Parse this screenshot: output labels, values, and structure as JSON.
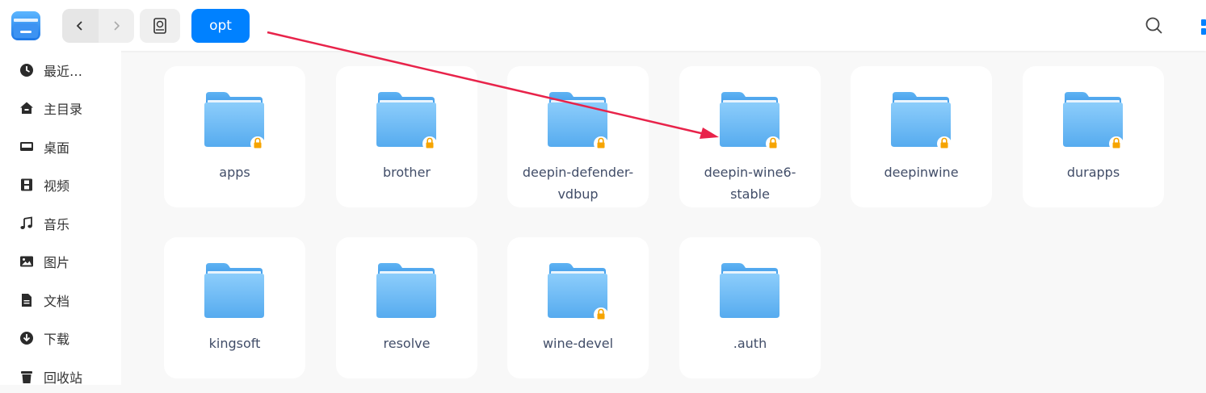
{
  "app": {
    "icon": "file-manager-icon"
  },
  "toolbar": {
    "back_icon": "chevron-left-icon",
    "forward_icon": "chevron-right-icon",
    "disk_icon": "hard-disk-icon",
    "breadcrumb": "opt",
    "search_icon": "search-icon",
    "view_icon": "view-mode-icon"
  },
  "sidebar": {
    "items": [
      {
        "label": "最近…",
        "icon": "clock-icon"
      },
      {
        "label": "主目录",
        "icon": "home-icon"
      },
      {
        "label": "桌面",
        "icon": "desktop-icon"
      },
      {
        "label": "视频",
        "icon": "film-icon"
      },
      {
        "label": "音乐",
        "icon": "music-note-icon"
      },
      {
        "label": "图片",
        "icon": "image-icon"
      },
      {
        "label": "文档",
        "icon": "document-icon"
      },
      {
        "label": "下载",
        "icon": "download-icon"
      },
      {
        "label": "回收站",
        "icon": "trash-icon"
      }
    ]
  },
  "files": [
    {
      "name": "apps",
      "locked": true
    },
    {
      "name": "brother",
      "locked": true
    },
    {
      "name": "deepin-defender-\nvdbup",
      "locked": true
    },
    {
      "name": "deepin-wine6-\nstable",
      "locked": true
    },
    {
      "name": "deepinwine",
      "locked": true
    },
    {
      "name": "durapps",
      "locked": true
    },
    {
      "name": "kingsoft",
      "locked": false
    },
    {
      "name": "resolve",
      "locked": false
    },
    {
      "name": "wine-devel",
      "locked": true
    },
    {
      "name": ".auth",
      "locked": false
    }
  ],
  "colors": {
    "accent": "#0081ff",
    "folder_top": "#7ec4f8",
    "folder_bottom": "#59aef0",
    "lock": "#f6a400",
    "annotation_arrow": "#e8234a"
  }
}
